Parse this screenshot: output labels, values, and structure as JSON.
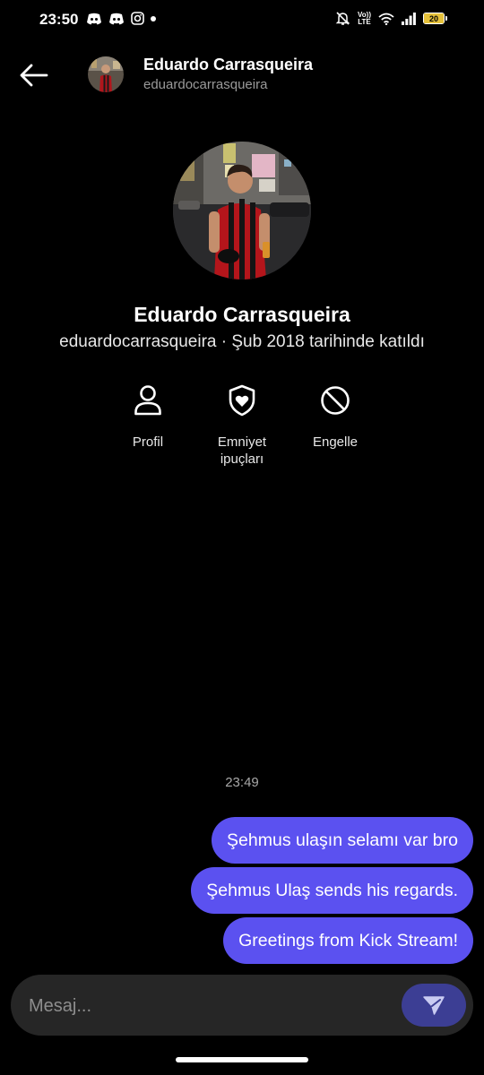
{
  "status_bar": {
    "time": "23:50",
    "left_icons": [
      "discord-icon",
      "discord-icon",
      "instagram-icon",
      "notification-dot-icon"
    ],
    "right_icons": [
      "bell-off-icon",
      "volte-icon",
      "wifi-icon",
      "cellular-signal-icon",
      "battery-icon"
    ],
    "volte_label": "VoLTE",
    "battery_level": "20",
    "battery_color": "#e5c13a"
  },
  "header": {
    "back_icon": "arrow-left-icon",
    "name": "Eduardo Carrasqueira",
    "username": "eduardocarrasqueira"
  },
  "profile": {
    "name": "Eduardo Carrasqueira",
    "subtitle": "eduardocarrasqueira · Şub 2018 tarihinde katıldı",
    "actions": [
      {
        "label": "Profil",
        "icon": "person-icon"
      },
      {
        "label": "Emniyet ipuçları",
        "icon": "shield-heart-icon"
      },
      {
        "label": "Engelle",
        "icon": "block-icon"
      }
    ]
  },
  "conversation": {
    "timestamp": "23:49",
    "messages": [
      {
        "text": "Şehmus ulaşın selamı var bro",
        "direction": "outgoing"
      },
      {
        "text": "Şehmus Ulaş sends his regards.",
        "direction": "outgoing"
      },
      {
        "text": "Greetings from Kick Stream!",
        "direction": "outgoing"
      }
    ]
  },
  "composer": {
    "placeholder": "Mesaj...",
    "value": "",
    "send_icon": "send-icon"
  },
  "colors": {
    "background": "#000000",
    "bubble": "#5b51f0",
    "composer": "#262626",
    "send_button": "#3c3e94"
  }
}
